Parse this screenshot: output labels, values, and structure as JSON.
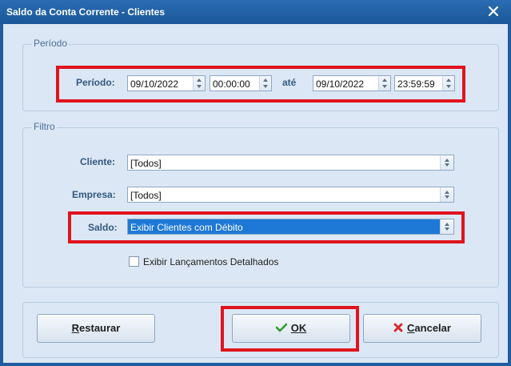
{
  "window": {
    "title": "Saldo da Conta Corrente - Clientes"
  },
  "periodo": {
    "legend": "Período",
    "label": "Período:",
    "start_date": "09/10/2022",
    "start_time": "00:00:00",
    "separator": "até",
    "end_date": "09/10/2022",
    "end_time": "23:59:59"
  },
  "filtro": {
    "legend": "Filtro",
    "cliente_label": "Cliente:",
    "cliente_value": "[Todos]",
    "empresa_label": "Empresa:",
    "empresa_value": "[Todos]",
    "saldo_label": "Saldo:",
    "saldo_value": "Exibir Clientes com Débito",
    "detalhados_label": "Exibir Lançamentos Detalhados",
    "detalhados_checked": false
  },
  "buttons": {
    "restaurar_u": "R",
    "restaurar_rest": "estaurar",
    "ok_label": "OK",
    "cancelar_u": "C",
    "cancelar_rest": "ancelar"
  },
  "icons": {
    "ok": "check-icon",
    "cancel": "x-icon",
    "close": "close-icon"
  },
  "colors": {
    "highlight": "#e0141e",
    "selection": "#1e78d6",
    "title_bar": "#1f5d9f"
  }
}
